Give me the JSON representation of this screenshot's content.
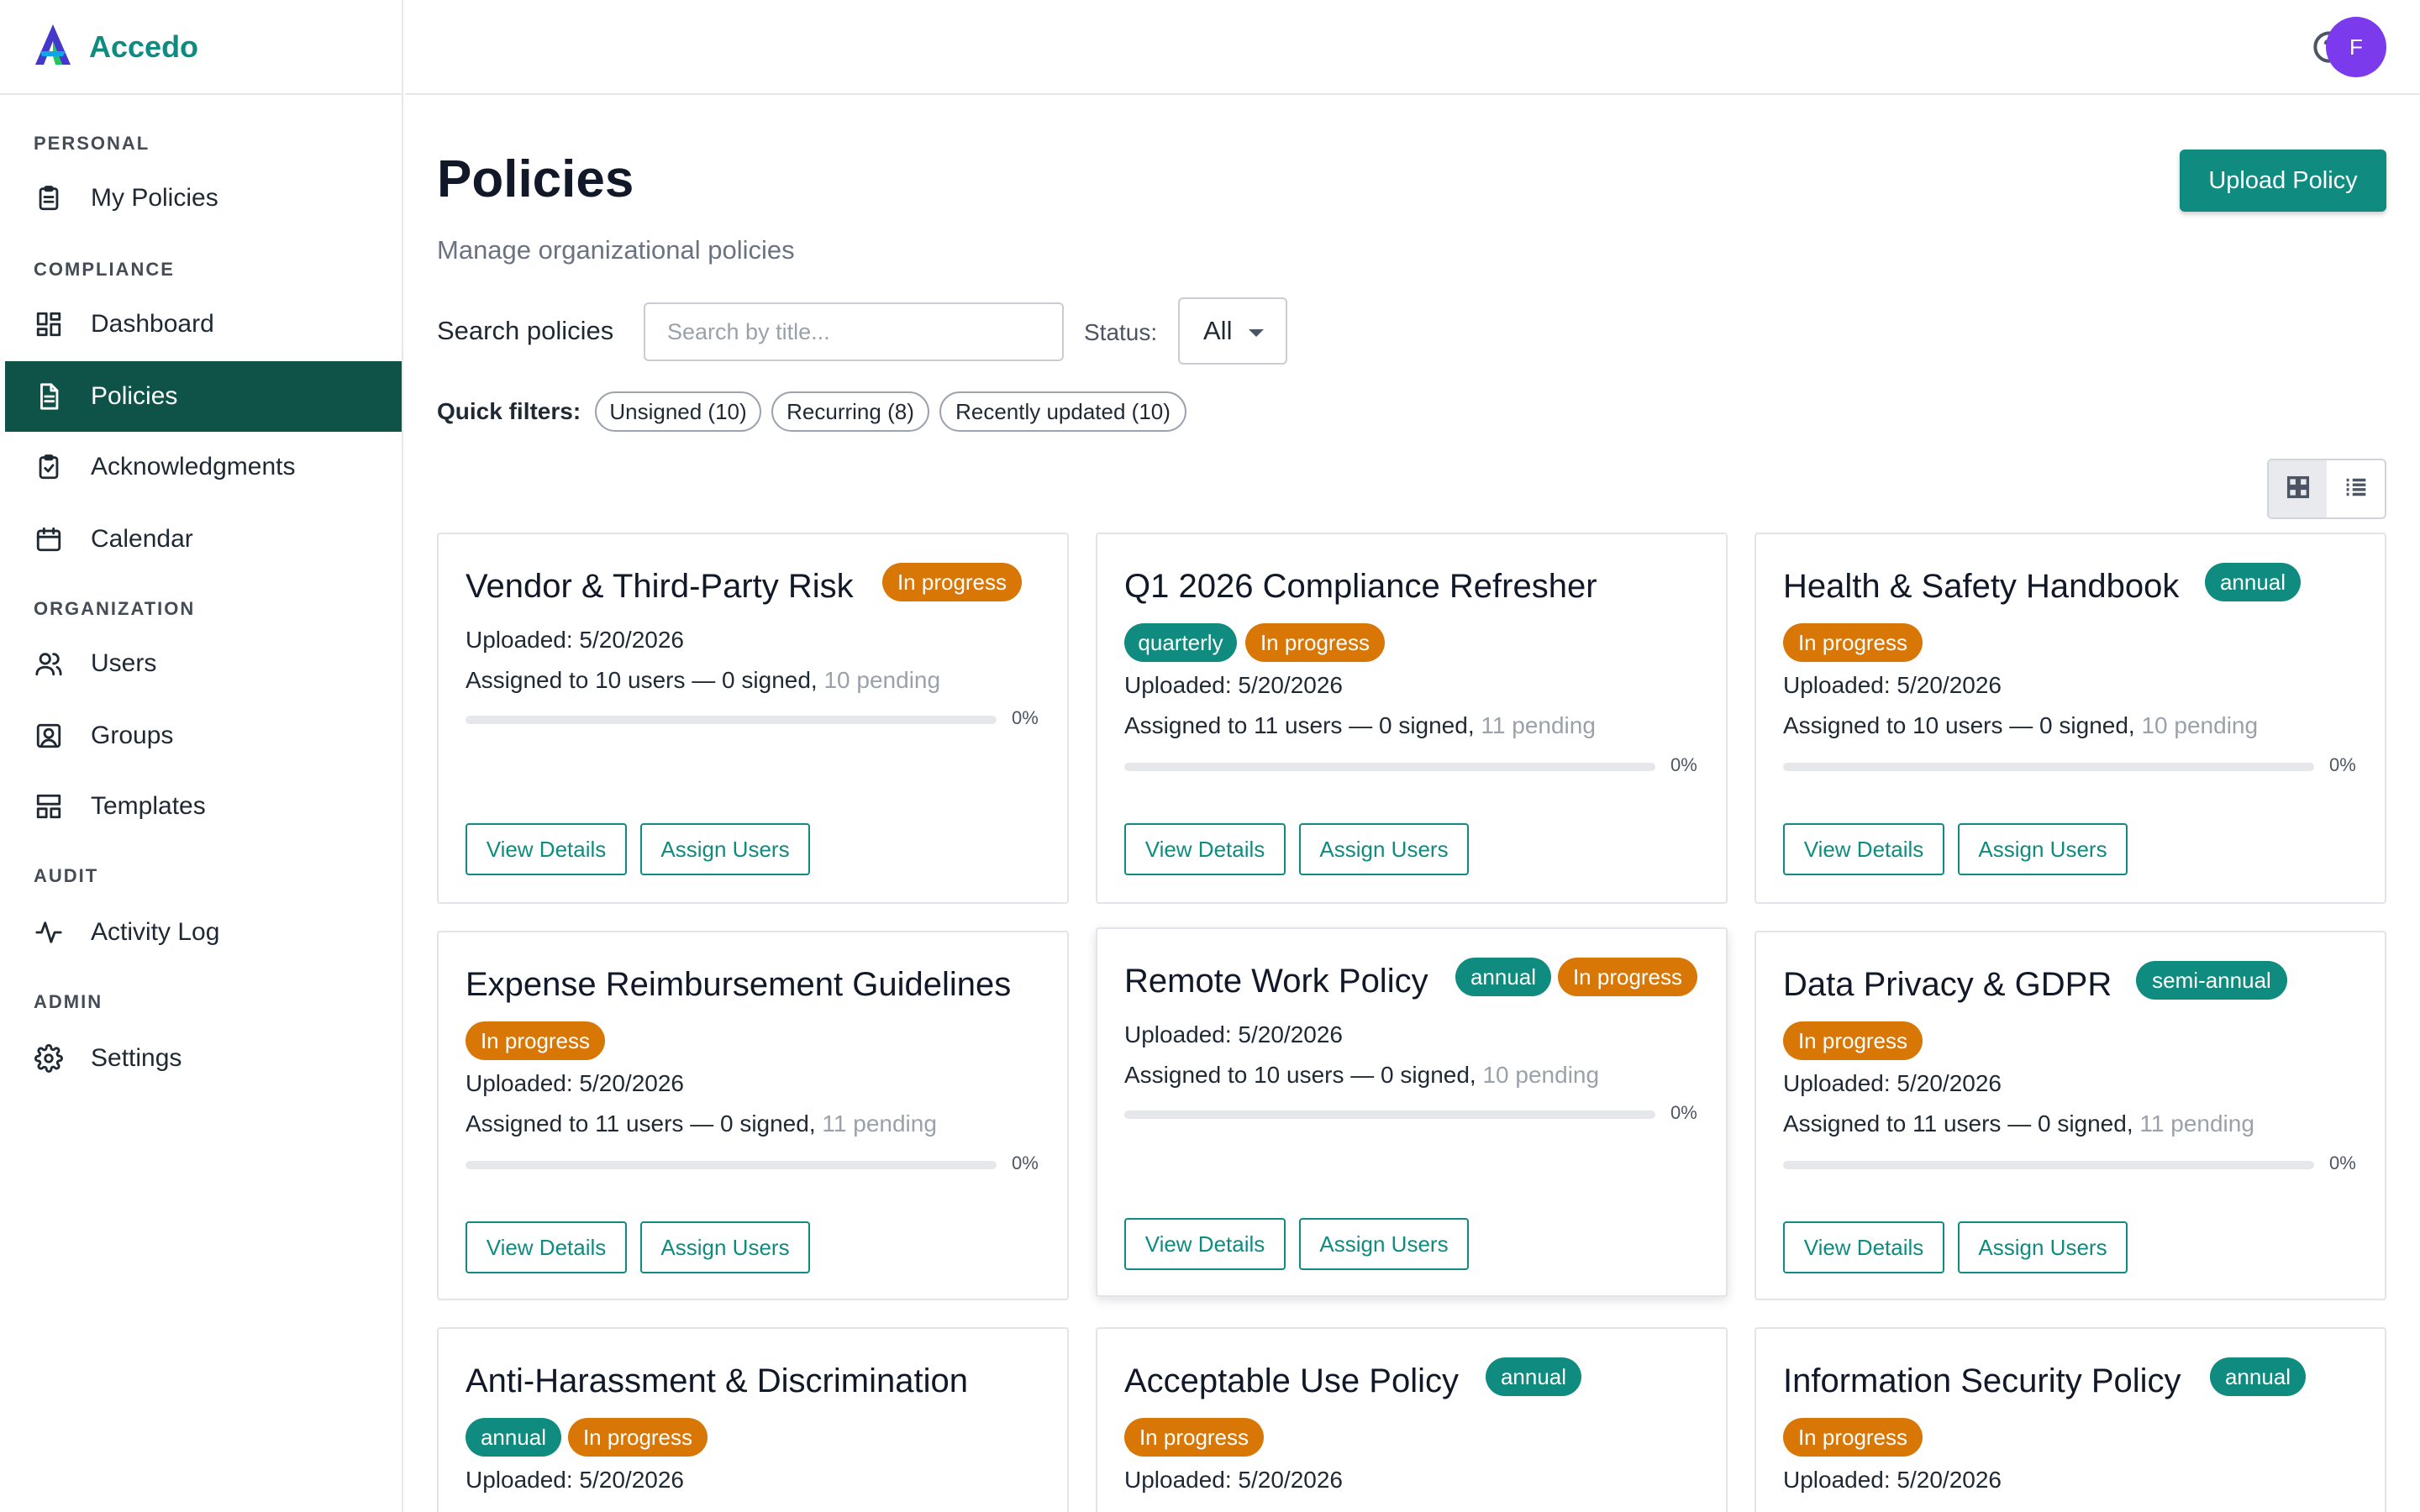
{
  "brand": {
    "name": "Accedo"
  },
  "nav": {
    "sections": {
      "personal": "PERSONAL",
      "compliance": "COMPLIANCE",
      "organization": "ORGANIZATION",
      "audit": "AUDIT",
      "admin": "ADMIN"
    },
    "items": [
      {
        "label": "My Policies",
        "icon": "clipboard-icon",
        "active": false
      },
      {
        "label": "Dashboard",
        "icon": "dashboard-icon",
        "active": false
      },
      {
        "label": "Policies",
        "icon": "document-icon",
        "active": true
      },
      {
        "label": "Acknowledgments",
        "icon": "clipboard-check-icon",
        "active": false
      },
      {
        "label": "Calendar",
        "icon": "calendar-icon",
        "active": false
      },
      {
        "label": "Users",
        "icon": "users-icon",
        "active": false
      },
      {
        "label": "Groups",
        "icon": "group-icon",
        "active": false
      },
      {
        "label": "Templates",
        "icon": "templates-icon",
        "active": false
      },
      {
        "label": "Activity Log",
        "icon": "activity-icon",
        "active": false
      },
      {
        "label": "Settings",
        "icon": "gear-icon",
        "active": false
      }
    ]
  },
  "topbar": {
    "avatar_initial": "F",
    "help_icon": "help-icon"
  },
  "page": {
    "title": "Policies",
    "subtitle": "Manage organizational policies",
    "upload_label": "Upload Policy"
  },
  "filters": {
    "search_label": "Search policies",
    "search_placeholder": "Search by title...",
    "search_value": "",
    "status_label": "Status:",
    "status_value": "All",
    "quick_label": "Quick filters:",
    "chips": [
      "Unsigned (10)",
      "Recurring (8)",
      "Recently updated (10)"
    ]
  },
  "view": {
    "mode": "grid"
  },
  "colors": {
    "accent": "#0f8b80",
    "sidebar_active": "#0f5348",
    "in_progress": "#d97706",
    "avatar": "#7c3aed"
  },
  "cards": [
    {
      "title": "Vendor & Third-Party Risk",
      "badges": [
        {
          "text": "In progress",
          "kind": "orange"
        }
      ],
      "uploaded": "Uploaded: 5/20/2026",
      "assigned": "Assigned to 10 users — 0 signed",
      "pending": "10 pending",
      "progress": 0,
      "pct": "0%",
      "view_label": "View Details",
      "assign_label": "Assign Users"
    },
    {
      "title": "Q1 2026 Compliance Refresher",
      "badges": [
        {
          "text": "quarterly",
          "kind": "teal"
        },
        {
          "text": "In progress",
          "kind": "orange"
        }
      ],
      "uploaded": "Uploaded: 5/20/2026",
      "assigned": "Assigned to 11 users — 0 signed",
      "pending": "11 pending",
      "progress": 0,
      "pct": "0%",
      "view_label": "View Details",
      "assign_label": "Assign Users"
    },
    {
      "title": "Health & Safety Handbook",
      "badges": [
        {
          "text": "annual",
          "kind": "teal"
        },
        {
          "text": "In progress",
          "kind": "orange"
        }
      ],
      "uploaded": "Uploaded: 5/20/2026",
      "assigned": "Assigned to 10 users — 0 signed",
      "pending": "10 pending",
      "progress": 0,
      "pct": "0%",
      "view_label": "View Details",
      "assign_label": "Assign Users"
    },
    {
      "title": "Expense Reimbursement Guidelines",
      "badges": [
        {
          "text": "In progress",
          "kind": "orange"
        }
      ],
      "uploaded": "Uploaded: 5/20/2026",
      "assigned": "Assigned to 11 users — 0 signed",
      "pending": "11 pending",
      "progress": 0,
      "pct": "0%",
      "view_label": "View Details",
      "assign_label": "Assign Users"
    },
    {
      "title": "Remote Work Policy",
      "badges": [
        {
          "text": "annual",
          "kind": "teal"
        },
        {
          "text": "In progress",
          "kind": "orange"
        }
      ],
      "uploaded": "Uploaded: 5/20/2026",
      "assigned": "Assigned to 10 users — 0 signed",
      "pending": "10 pending",
      "progress": 0,
      "pct": "0%",
      "view_label": "View Details",
      "assign_label": "Assign Users"
    },
    {
      "title": "Data Privacy & GDPR",
      "badges": [
        {
          "text": "semi-annual",
          "kind": "teal"
        },
        {
          "text": "In progress",
          "kind": "orange"
        }
      ],
      "uploaded": "Uploaded: 5/20/2026",
      "assigned": "Assigned to 11 users — 0 signed",
      "pending": "11 pending",
      "progress": 0,
      "pct": "0%",
      "view_label": "View Details",
      "assign_label": "Assign Users"
    },
    {
      "title": "Anti-Harassment & Discrimination",
      "badges": [
        {
          "text": "annual",
          "kind": "teal"
        },
        {
          "text": "In progress",
          "kind": "orange"
        }
      ],
      "uploaded": "Uploaded: 5/20/2026"
    },
    {
      "title": "Acceptable Use Policy",
      "badges": [
        {
          "text": "annual",
          "kind": "teal"
        },
        {
          "text": "In progress",
          "kind": "orange"
        }
      ],
      "uploaded": "Uploaded: 5/20/2026"
    },
    {
      "title": "Information Security Policy",
      "badges": [
        {
          "text": "annual",
          "kind": "teal"
        },
        {
          "text": "In progress",
          "kind": "orange"
        }
      ],
      "uploaded": "Uploaded: 5/20/2026"
    }
  ]
}
